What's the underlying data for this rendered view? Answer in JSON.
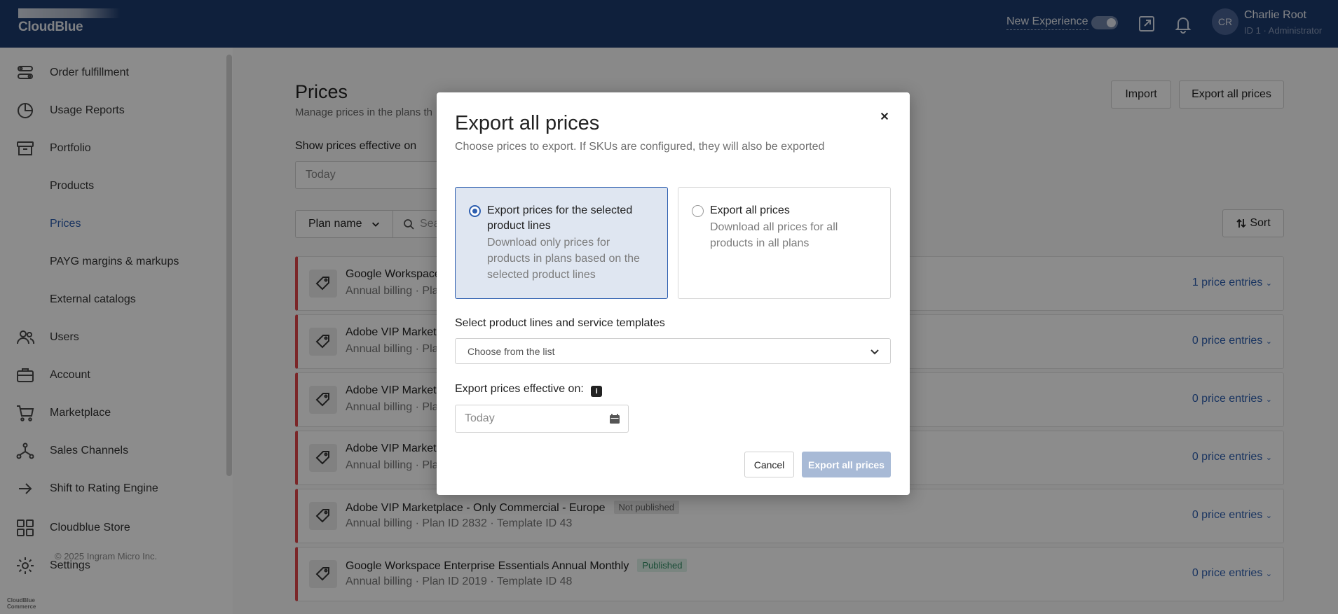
{
  "app": {
    "logo_text": "CloudBlue",
    "footer_logo_line1": "CloudBlue",
    "footer_logo_line2": "Commerce",
    "copyright": "© 2025 Ingram Micro Inc."
  },
  "topbar": {
    "new_experience_label": "New Experience",
    "toggle_on": true,
    "avatar_initials": "CR",
    "user_name": "Charlie Root",
    "user_role": "ID 1 · Administrator"
  },
  "sidebar": {
    "items": [
      {
        "label": "Order fulfillment",
        "icon": "order-fulfillment-icon"
      },
      {
        "label": "Usage Reports",
        "icon": "pie-chart-icon"
      },
      {
        "label": "Portfolio",
        "icon": "archive-icon"
      },
      {
        "label": "Products",
        "sub": true
      },
      {
        "label": "Prices",
        "sub": true,
        "active": true
      },
      {
        "label": "PAYG margins & markups",
        "sub": true
      },
      {
        "label": "External catalogs",
        "sub": true
      },
      {
        "label": "Users",
        "icon": "users-icon"
      },
      {
        "label": "Account",
        "icon": "briefcase-icon"
      },
      {
        "label": "Marketplace",
        "icon": "cart-icon"
      },
      {
        "label": "Sales Channels",
        "icon": "network-icon"
      },
      {
        "label": "Shift to Rating Engine",
        "icon": "arrow-right-icon"
      },
      {
        "label": "Cloudblue Store",
        "icon": "grid-icon"
      },
      {
        "label": "Settings",
        "icon": "gear-icon"
      }
    ]
  },
  "main": {
    "title": "Prices",
    "subtitle": "Manage prices in the plans th",
    "import_label": "Import",
    "export_all_label": "Export all prices",
    "effective_label": "Show prices effective on",
    "effective_value": "Today",
    "plan_filter_label": "Plan name",
    "search_placeholder": "Sea",
    "sort_label": "Sort",
    "rows": [
      {
        "name": "Google Workspace",
        "badge": "",
        "meta": "Annual billing · Pla",
        "count": "1 price entries"
      },
      {
        "name": "Adobe VIP Market",
        "badge": "",
        "meta": "Annual billing · Pla",
        "count": "0 price entries"
      },
      {
        "name": "Adobe VIP Market",
        "badge": "",
        "meta": "Annual billing · Pla",
        "count": "0 price entries"
      },
      {
        "name": "Adobe VIP Market",
        "badge": "",
        "meta": "Annual billing · Pla",
        "count": "0 price entries"
      },
      {
        "name": "Adobe VIP Marketplace - Only Commercial - Europe",
        "badge": "Not published",
        "meta": "Annual billing · Plan ID 2832 · Template ID 43",
        "count": "0 price entries"
      },
      {
        "name": "Google Workspace Enterprise Essentials Annual Monthly",
        "badge": "Published",
        "meta": "Annual billing · Plan ID 2019 · Template ID 48",
        "count": "0 price entries"
      }
    ]
  },
  "modal": {
    "title": "Export all prices",
    "subtitle": "Choose prices to export. If SKUs are configured, they will also be exported",
    "option_selected": {
      "title": "Export prices for the selected product lines",
      "desc": "Download only prices for products in plans based on the selected product lines"
    },
    "option_all": {
      "title": "Export all prices",
      "desc": "Download all prices for all products in all plans"
    },
    "product_lines_label": "Select product lines and service templates",
    "product_lines_placeholder": "Choose from the list",
    "effective_label": "Export prices effective on:",
    "effective_value": "Today",
    "cancel_label": "Cancel",
    "export_label": "Export all prices"
  }
}
